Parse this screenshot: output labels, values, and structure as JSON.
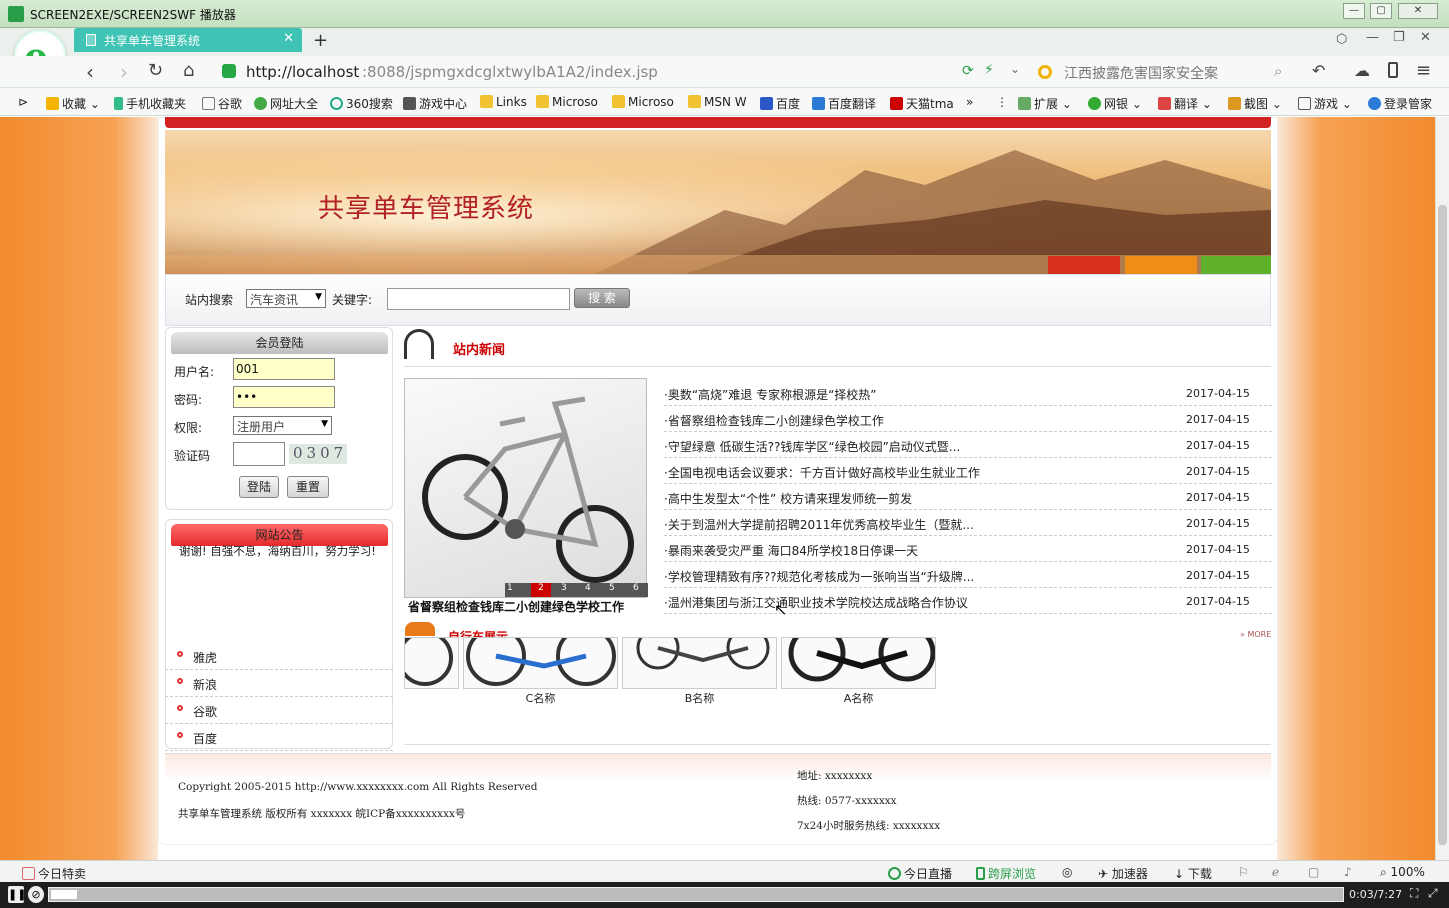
{
  "window": {
    "title": "SCREEN2EXE/SCREEN2SWF 播放器"
  },
  "browser": {
    "tab_title": "共享单车管理系统",
    "url_host": "http://localhost",
    "url_rest": ":8088/jspmgxdcglxtwylbA1A2/index.jsp",
    "search_placeholder": "江西披露危害国家安全案",
    "bookmarks": [
      "收藏",
      "手机收藏夹",
      "谷歌",
      "网址大全",
      "360搜索",
      "游戏中心",
      "Links",
      "Microso",
      "Microso",
      "MSN W",
      "百度",
      "百度翻译",
      "天猫tma"
    ],
    "extras": [
      "扩展",
      "网银",
      "翻译",
      "截图",
      "游戏",
      "登录管家"
    ]
  },
  "site": {
    "banner_title": "共享单车管理系统",
    "search": {
      "label": "站内搜索",
      "type_value": "汽车资讯",
      "keyword_label": "关键字:",
      "button": "搜 索"
    },
    "login": {
      "title": "会员登陆",
      "user_label": "用户名:",
      "user_value": "001",
      "pass_label": "密码:",
      "pass_value": "•••",
      "role_label": "权限:",
      "role_value": "注册用户",
      "captcha_label": "验证码",
      "captcha_image_text": "0307",
      "login_button": "登陆",
      "reset_button": "重置"
    },
    "notice": {
      "title": "网站公告",
      "text": "谢谢!   自强不息，海纳百川，努力学习!"
    },
    "links": [
      "雅虎",
      "新浪",
      "谷歌",
      "百度"
    ],
    "news": {
      "title": "站内新闻",
      "photo_caption": "省督察组检查钱库二小创建绿色学校工作",
      "pager": [
        "1",
        "2",
        "3",
        "4",
        "5",
        "6"
      ],
      "items": [
        {
          "title": "·奥数“高烧”难退 专家称根源是“择校热”",
          "date": "2017-04-15"
        },
        {
          "title": "·省督察组检查钱库二小创建绿色学校工作",
          "date": "2017-04-15"
        },
        {
          "title": "·守望绿意 低碳生活??钱库学区“绿色校园”启动仪式暨...",
          "date": "2017-04-15"
        },
        {
          "title": "·全国电视电话会议要求：千方百计做好高校毕业生就业工作",
          "date": "2017-04-15"
        },
        {
          "title": "·高中生发型太“个性” 校方请来理发师统一剪发",
          "date": "2017-04-15"
        },
        {
          "title": "·关于到温州大学提前招聘2011年优秀高校毕业生（暨就...",
          "date": "2017-04-15"
        },
        {
          "title": "·暴雨来袭受灾严重 海口84所学校18日停课一天",
          "date": "2017-04-15"
        },
        {
          "title": "·学校管理精致有序??规范化考核成为一张响当当“升级牌...",
          "date": "2017-04-15"
        },
        {
          "title": "·温州港集团与浙江交通职业技术学院校达成战略合作协议",
          "date": "2017-04-15"
        }
      ]
    },
    "bikes": {
      "title": "自行车展示",
      "more": "MORE",
      "captions": [
        "C名称",
        "B名称",
        "A名称"
      ]
    },
    "footer": {
      "copyright": "Copyright 2005-2015 http://www.xxxxxxxx.com All Rights Reserved",
      "owner": "共享单车管理系统 版权所有 xxxxxxx 皖ICP备xxxxxxxxxx号",
      "address": "地址: xxxxxxxx",
      "hotline": "热线: 0577-xxxxxxx",
      "service": "7x24小时服务热线: xxxxxxxx"
    }
  },
  "statusbar": {
    "left": "今日特卖",
    "items": [
      "今日直播",
      "跨屏浏览",
      "加速器",
      "下载"
    ],
    "zoom": "100%"
  },
  "player": {
    "time": "0:03/7:27"
  }
}
